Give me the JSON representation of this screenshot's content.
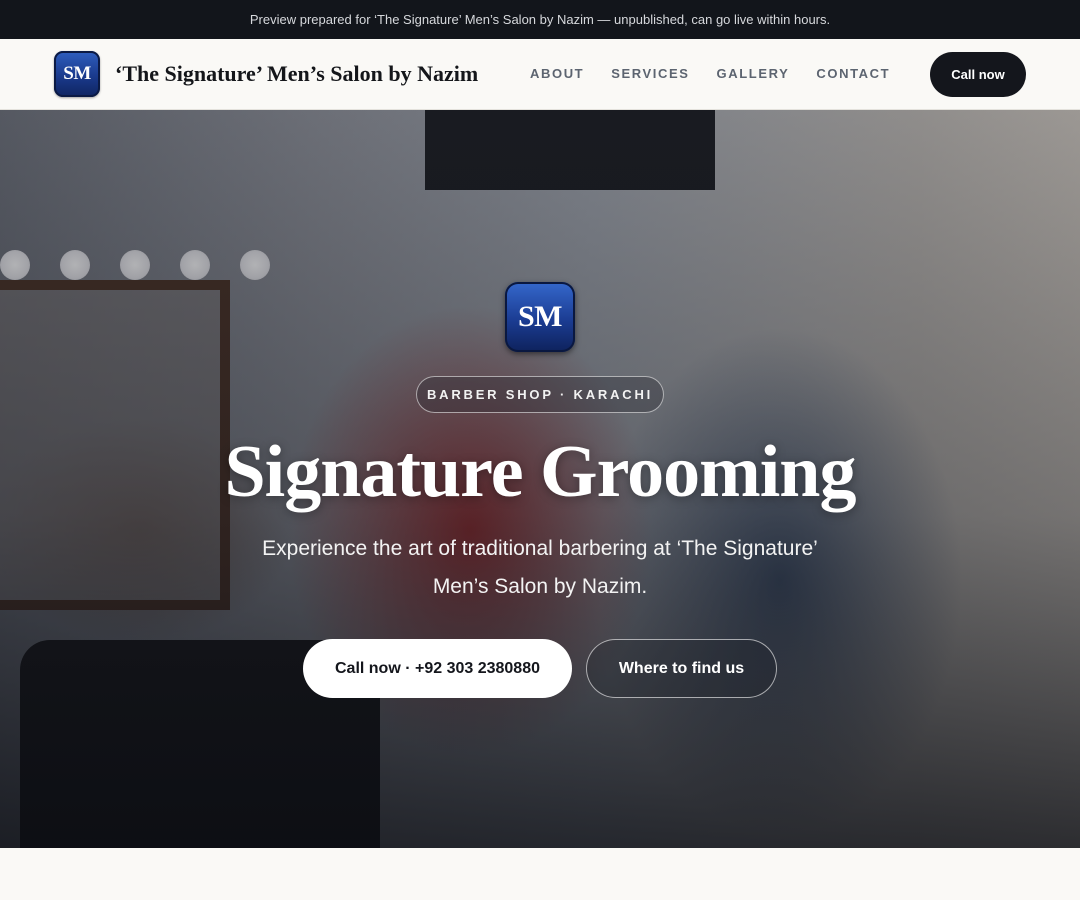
{
  "preview_banner": {
    "text": "Preview prepared for ‘The Signature’ Men’s Salon by Nazim — unpublished, can go live within hours."
  },
  "header": {
    "logo_text": "SM",
    "brand_name": "‘The Signature’ Men’s Salon by Nazim",
    "nav": [
      {
        "label": "ABOUT"
      },
      {
        "label": "SERVICES"
      },
      {
        "label": "GALLERY"
      },
      {
        "label": "CONTACT"
      }
    ],
    "cta_label": "Call now"
  },
  "hero": {
    "logo_text": "SM",
    "tagline": "BARBER SHOP · KARACHI",
    "title": "Signature Grooming",
    "subtitle": "Experience the art of traditional barbering at ‘The Signature’ Men’s Salon by Nazim.",
    "primary_button": "Call now · +92 303 2380880",
    "secondary_button": "Where to find us",
    "background_image": "barbershop-photo"
  },
  "colors": {
    "dark": "#14161c",
    "logo_blue": "#1a3a8c",
    "page_bg": "#faf9f6"
  }
}
